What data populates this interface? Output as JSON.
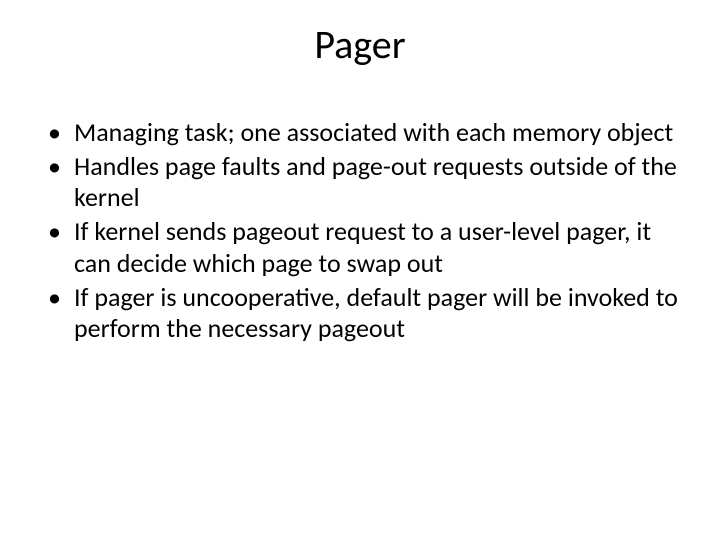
{
  "title": "Pager",
  "bullets": [
    "Managing task; one associated with each memory object",
    "Handles page faults and page-out requests outside of the kernel",
    "If kernel sends pageout request to a user-level pager, it can decide which page to swap out",
    "If pager is uncooperative, default pager will be invoked to perform the necessary pageout"
  ]
}
